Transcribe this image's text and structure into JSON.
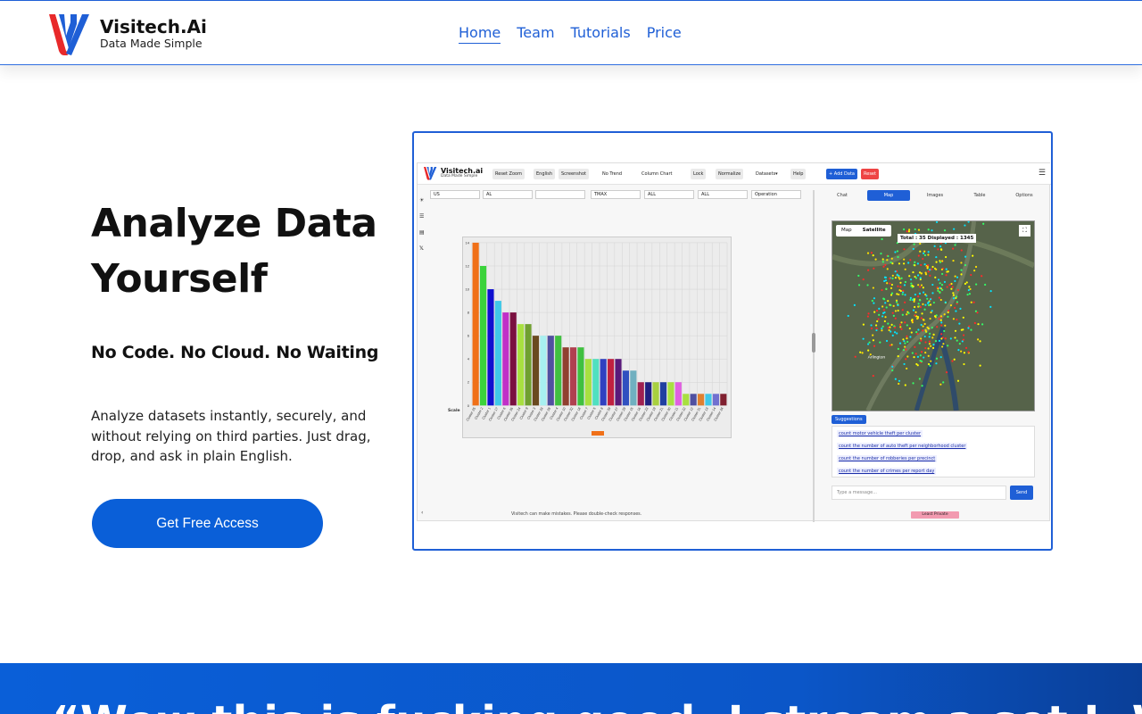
{
  "brand": {
    "title": "Visitech.Ai",
    "subtitle": "Data Made Simple",
    "colors": {
      "accent": "#1f5fd6",
      "logo_red": "#e8292a",
      "logo_blue": "#1f5fd6"
    }
  },
  "nav": {
    "items": [
      {
        "label": "Home",
        "active": true
      },
      {
        "label": "Team"
      },
      {
        "label": "Tutorials"
      },
      {
        "label": "Price"
      }
    ]
  },
  "hero": {
    "title": "Analyze Data Yourself",
    "subtitle": "No Code. No Cloud. No Waiting",
    "description": "Analyze datasets instantly, securely, and without relying on third parties. Just drag, drop, and ask in plain English.",
    "cta_label": "Get Free Access"
  },
  "app_preview": {
    "brand_title": "Visitech.ai",
    "brand_subtitle": "Data Made Simple",
    "toolbar": {
      "reset_zoom": "Reset Zoom",
      "language": "English",
      "screenshot": "Screenshot",
      "trend": "No Trend",
      "chart_type": "Column Chart",
      "lock": "Lock",
      "normalize": "Normalize",
      "datasets": "Datasets▾",
      "help": "Help",
      "add_data": "+ Add Data",
      "reset": "Reset"
    },
    "filters": [
      "US",
      "AL",
      "",
      "TMAX",
      "ALL",
      "ALL",
      "Operation"
    ],
    "side_icons": [
      "sun-icon",
      "sliders-icon",
      "layers-icon",
      "x-icon"
    ],
    "tabs": [
      "Chat",
      "Map",
      "Images",
      "Table",
      "Options"
    ],
    "active_tab": "Map",
    "map": {
      "tab_map": "Map",
      "tab_satellite": "Satellite",
      "total_label": "Total : 35 Displayed : 1345",
      "place_label": "Arlington"
    },
    "suggestions_label": "Suggestions",
    "suggestions": [
      "count motor vehicle theft per cluster",
      "count the number of auto theft per neighborhood cluster",
      "count the number of robberies per precinct",
      "count the number of crimes per report day"
    ],
    "input_placeholder": "Type a message...",
    "send_label": "Send",
    "privacy_label": "Least Private",
    "disclaimer": "Visitech can make mistakes. Please double-check responses.",
    "scale_label": "Scale"
  },
  "chart_data": {
    "type": "bar",
    "categories": [
      "Cluster 25",
      "Cluster 2",
      "Cluster 1",
      "Cluster 17",
      "Cluster 6",
      "Cluster 26",
      "Cluster 24",
      "Cluster 9",
      "Cluster 3",
      "Cluster 33",
      "Cluster 28",
      "Cluster 4",
      "Cluster 10",
      "Cluster 32",
      "Cluster 18",
      "Cluster 7",
      "Cluster 5",
      "Cluster 8",
      "Cluster 39",
      "Cluster 27",
      "Cluster 29",
      "Cluster 15",
      "Cluster 16",
      "Cluster 23",
      "Cluster 19",
      "Cluster 21",
      "Cluster 30",
      "Cluster 11",
      "Cluster 22",
      "Cluster 12",
      "Cluster 31",
      "Cluster 13",
      "Cluster 14",
      "Cluster 34"
    ],
    "values": [
      14,
      12,
      10,
      9,
      8,
      8,
      7,
      7,
      6,
      6,
      6,
      6,
      5,
      5,
      5,
      4,
      4,
      4,
      4,
      4,
      3,
      3,
      2,
      2,
      2,
      2,
      2,
      2,
      1,
      1,
      1,
      1,
      1,
      1
    ],
    "colors": [
      "#f07018",
      "#3bd33b",
      "#1010d0",
      "#40c8e8",
      "#c030c8",
      "#7a1040",
      "#a8e040",
      "#70a030",
      "#6a4a20",
      "#a8f0f0",
      "#5050a0",
      "#40c040",
      "#904030",
      "#b04050",
      "#40c040",
      "#a8e040",
      "#50e0c0",
      "#3040c0",
      "#c02040",
      "#5a1a7a",
      "#3050c0",
      "#70b0c0",
      "#a02050",
      "#202080",
      "#a8d040",
      "#2040a0",
      "#a8e040",
      "#e060e0",
      "#a8e040",
      "#5050a0",
      "#e08030",
      "#40c8e8",
      "#7070d0",
      "#802030"
    ],
    "ylim": [
      0,
      14
    ],
    "yticks": [
      0,
      2,
      4,
      6,
      8,
      10,
      12,
      14
    ],
    "legend_color": "#f07018",
    "xlabel": "Scale"
  },
  "testimonial": {
    "text": "“Wow this is fucking good. I stream a set I. Well and I can see instantly"
  }
}
